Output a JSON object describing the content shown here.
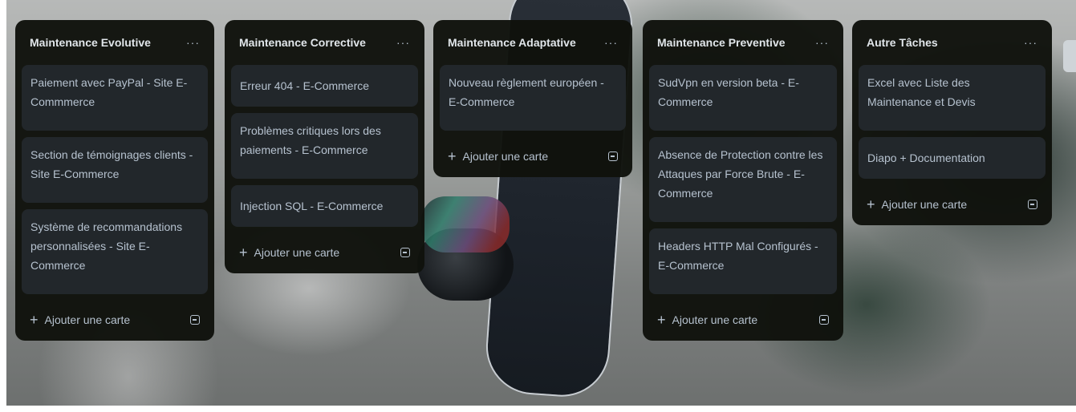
{
  "lists": [
    {
      "title": "Maintenance Evolutive",
      "menu_glyph": "···",
      "cards": [
        "Paiement avec PayPal - Site E-Commmerce",
        "Section de témoignages clients - Site E-Commerce",
        "Système de recommandations personnalisées - Site E-Commerce"
      ],
      "add_label": "Ajouter une carte"
    },
    {
      "title": "Maintenance Corrective",
      "menu_glyph": "···",
      "cards": [
        "Erreur 404 - E-Commerce",
        "Problèmes critiques lors des paiements - E-Commerce",
        "Injection SQL - E-Commerce"
      ],
      "add_label": "Ajouter une carte"
    },
    {
      "title": "Maintenance Adaptative",
      "menu_glyph": "···",
      "cards": [
        "Nouveau règlement européen - E-Commerce"
      ],
      "add_label": "Ajouter une carte"
    },
    {
      "title": "Maintenance Preventive",
      "menu_glyph": "···",
      "cards": [
        "SudVpn en version beta - E-Commerce",
        "Absence de Protection contre les Attaques par Force Brute - E-Commerce",
        "Headers HTTP Mal Configurés - E-Commerce"
      ],
      "add_label": "Ajouter une carte"
    },
    {
      "title": "Autre Tâches",
      "menu_glyph": "···",
      "cards": [
        "Excel avec Liste des Maintenance et Devis",
        "Diapo + Documentation"
      ],
      "add_label": "Ajouter une carte"
    }
  ],
  "colors": {
    "list_bg": "#101204",
    "card_bg": "#22272b",
    "text": "#b6c2cf",
    "title": "#e1e6ea"
  },
  "icons": {
    "list_menu": "more-horizontal-icon",
    "add": "plus-icon",
    "template": "card-template-icon"
  }
}
